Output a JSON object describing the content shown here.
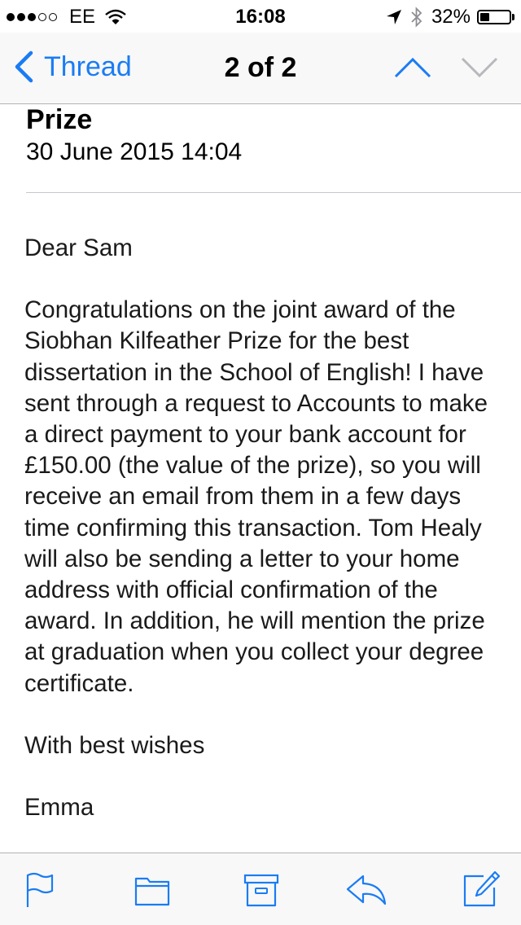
{
  "status_bar": {
    "carrier": "EE",
    "signal_bars_filled": 3,
    "signal_bars_total": 5,
    "time": "16:08",
    "battery_percent": "32%",
    "battery_level": 0.32,
    "icons": [
      "wifi-icon",
      "location-arrow-icon",
      "bluetooth-icon",
      "battery-icon"
    ]
  },
  "nav": {
    "back_label": "Thread",
    "title": "2 of 2",
    "icons": [
      "chevron-left-icon",
      "chevron-up-icon",
      "chevron-down-icon"
    ],
    "accent": "#1a7cf4",
    "disabled_color": "#b8b8bd"
  },
  "message": {
    "subject": "Prize",
    "date": "30 June 2015 14:04",
    "greeting": "Dear Sam",
    "paragraph": "Congratulations on the joint award of the Siobhan Kilfeather Prize for the best dissertation  in the School of English!  I have sent through a request to Accounts to make a direct payment to your bank account for £150.00 (the value of the prize), so you will receive an email from them in a few days time confirming this transaction.  Tom Healy will also be sending a letter to your home address with official confirmation of the award.  In addition, he will mention the prize at graduation when you collect your degree certificate.",
    "closing": "With best wishes",
    "signature": "Emma"
  },
  "toolbar": {
    "icons": [
      "flag-icon",
      "folder-icon",
      "archive-icon",
      "reply-icon",
      "compose-icon"
    ],
    "color": "#1a7cf4"
  }
}
